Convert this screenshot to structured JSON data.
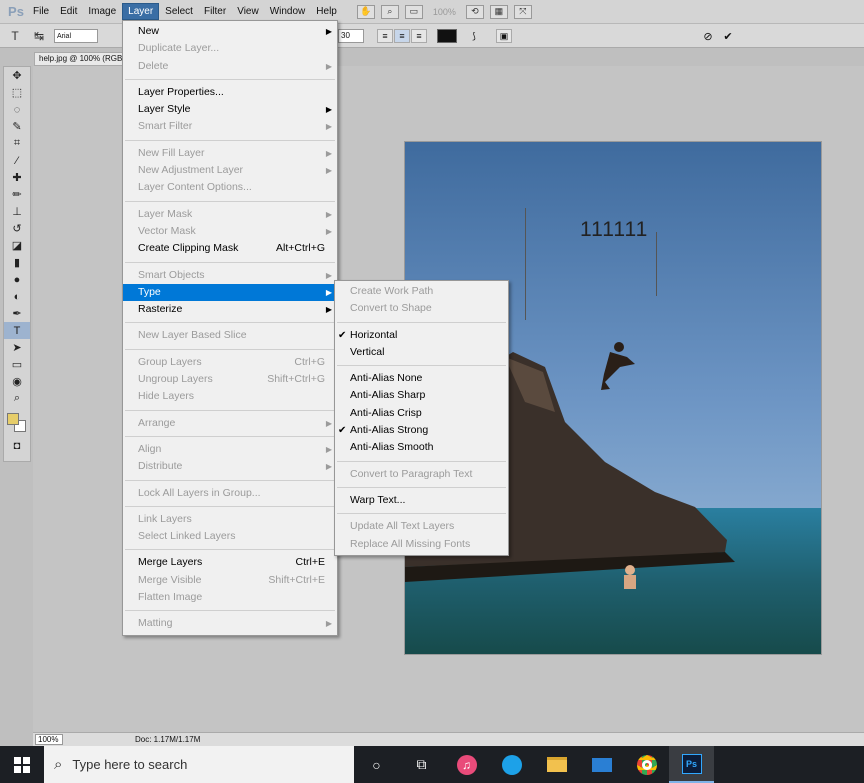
{
  "menubar": {
    "logo": "Ps",
    "items": [
      "File",
      "Edit",
      "Image",
      "Layer",
      "Select",
      "Filter",
      "View",
      "Window",
      "Help"
    ],
    "zoom": "100%"
  },
  "options": {
    "font": "Arial",
    "size": "30"
  },
  "document": {
    "tab": "help.jpg @ 100% (RGB",
    "text_layer": "111111",
    "zoom": "100%",
    "doc_info": "Doc: 1.17M/1.17M"
  },
  "layer_menu": {
    "new": "New",
    "duplicate": "Duplicate Layer...",
    "delete": "Delete",
    "properties": "Layer Properties...",
    "style": "Layer Style",
    "smart_filter": "Smart Filter",
    "new_fill": "New Fill Layer",
    "new_adj": "New Adjustment Layer",
    "content_opts": "Layer Content Options...",
    "layer_mask": "Layer Mask",
    "vector_mask": "Vector Mask",
    "clipping_mask": "Create Clipping Mask",
    "clipping_sc": "Alt+Ctrl+G",
    "smart_objects": "Smart Objects",
    "type": "Type",
    "rasterize": "Rasterize",
    "slice": "New Layer Based Slice",
    "group": "Group Layers",
    "group_sc": "Ctrl+G",
    "ungroup": "Ungroup Layers",
    "ungroup_sc": "Shift+Ctrl+G",
    "hide": "Hide Layers",
    "arrange": "Arrange",
    "align": "Align",
    "distribute": "Distribute",
    "lock_all": "Lock All Layers in Group...",
    "link": "Link Layers",
    "select_linked": "Select Linked Layers",
    "merge": "Merge Layers",
    "merge_sc": "Ctrl+E",
    "merge_visible": "Merge Visible",
    "merge_visible_sc": "Shift+Ctrl+E",
    "flatten": "Flatten Image",
    "matting": "Matting"
  },
  "type_menu": {
    "work_path": "Create Work Path",
    "to_shape": "Convert to Shape",
    "horizontal": "Horizontal",
    "vertical": "Vertical",
    "aa_none": "Anti-Alias None",
    "aa_sharp": "Anti-Alias Sharp",
    "aa_crisp": "Anti-Alias Crisp",
    "aa_strong": "Anti-Alias Strong",
    "aa_smooth": "Anti-Alias Smooth",
    "to_paragraph": "Convert to Paragraph Text",
    "warp": "Warp Text...",
    "update_all": "Update All Text Layers",
    "replace_fonts": "Replace All Missing Fonts"
  },
  "taskbar": {
    "search_placeholder": "Type here to search",
    "ps_label": "Ps"
  }
}
